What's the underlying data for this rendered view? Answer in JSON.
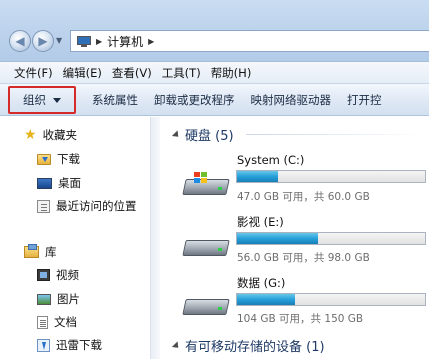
{
  "address": {
    "location_icon": "computer-icon",
    "crumb": "计算机"
  },
  "menu": [
    "文件(F)",
    "编辑(E)",
    "查看(V)",
    "工具(T)",
    "帮助(H)"
  ],
  "toolbar": {
    "organize": "组织",
    "commands": [
      "系统属性",
      "卸载或更改程序",
      "映射网络驱动器",
      "打开控"
    ]
  },
  "nav": {
    "favorites": {
      "label": "收藏夹",
      "items": [
        {
          "label": "下载",
          "icon": "download-folder-icon"
        },
        {
          "label": "桌面",
          "icon": "desktop-icon"
        },
        {
          "label": "最近访问的位置",
          "icon": "recent-places-icon"
        }
      ]
    },
    "libraries": {
      "label": "库",
      "items": [
        {
          "label": "视频",
          "icon": "video-library-icon"
        },
        {
          "label": "图片",
          "icon": "pictures-library-icon"
        },
        {
          "label": "文档",
          "icon": "documents-library-icon"
        },
        {
          "label": "迅雷下载",
          "icon": "thunder-download-icon"
        }
      ]
    }
  },
  "content": {
    "hard_disks": {
      "title": "硬盘 (5)",
      "drives": [
        {
          "name": "System (C:)",
          "info": "47.0 GB 可用，共 60.0 GB",
          "used_fraction": 0.22
        },
        {
          "name": "影视 (E:)",
          "info": "56.0 GB 可用，共 98.0 GB",
          "used_fraction": 0.43
        },
        {
          "name": "数据 (G:)",
          "info": "104 GB 可用，共 150 GB",
          "used_fraction": 0.31
        }
      ]
    },
    "removable": {
      "title": "有可移动存储的设备 (1)"
    }
  },
  "colors": {
    "accent": "#26a0da",
    "highlight_border": "#d42a2a"
  }
}
